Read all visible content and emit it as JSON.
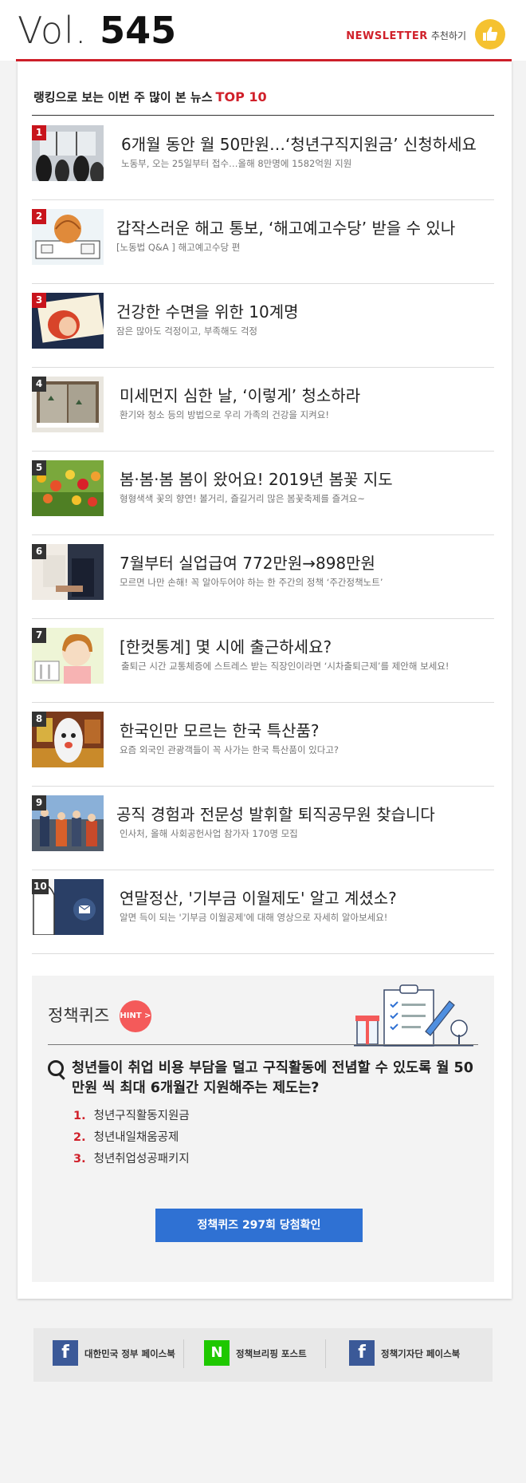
{
  "header": {
    "vol_prefix": "Vol.",
    "vol_number": "545",
    "newsletter_label": "NEWSLETTER",
    "recommend_label": "추천하기"
  },
  "ranking": {
    "title": "랭킹으로 보는 이번 주 많이 본 뉴스",
    "title_highlight": "TOP 10",
    "items": [
      {
        "rank": "1",
        "title": "6개월 동안 월 50만원…‘청년구직지원금’ 신청하세요",
        "subtitle": "노동부, 오는 25일부터 접수…올해 8만명에 1582억원 지원"
      },
      {
        "rank": "2",
        "title": "갑작스러운 해고 통보, ‘해고예고수당’ 받을 수 있나",
        "subtitle": "[노동법 Q&A ] 해고예고수당 편"
      },
      {
        "rank": "3",
        "title": "건강한 수면을 위한 10계명",
        "subtitle": "잠은 많아도 걱정이고, 부족해도 걱정"
      },
      {
        "rank": "4",
        "title": "미세먼지 심한 날, ‘이렇게’ 청소하라",
        "subtitle": "환기와 청소 등의 방법으로 우리 가족의 건강을 지켜요!"
      },
      {
        "rank": "5",
        "title": "봄·봄·봄 봄이 왔어요! 2019년 봄꽃 지도",
        "subtitle": "형형색색 꽃의 향연! 볼거리, 즐길거리 많은 봄꽃축제를 즐겨요~"
      },
      {
        "rank": "6",
        "title": "7월부터 실업급여 772만원→898만원",
        "subtitle": "모르면 나만 손해! 꼭 알아두어야 하는 한 주간의 정책 ‘주간정책노트’"
      },
      {
        "rank": "7",
        "title": "[한컷통계] 몇 시에 출근하세요?",
        "subtitle": "출퇴근 시간 교통체증에 스트레스 받는 직장인이라면 ‘시차출퇴근제’를 제안해 보세요!"
      },
      {
        "rank": "8",
        "title": "한국인만 모르는 한국 특산품?",
        "subtitle": "요즘 외국인 관광객들이 꼭 사가는 한국 특산품이 있다고?"
      },
      {
        "rank": "9",
        "title": "공직 경험과 전문성 발휘할 퇴직공무원 찾습니다",
        "subtitle": "인사처, 올해 사회공헌사업 참가자 170명 모집"
      },
      {
        "rank": "10",
        "title": "연말정산, '기부금 이월제도' 알고 계셨소?",
        "subtitle": "알면 득이 되는 '기부금 이월공제'에 대해 영상으로 자세히 알아보세요!"
      }
    ]
  },
  "quiz": {
    "title": "정책퀴즈",
    "hint_label": "HINT >",
    "question": "청년들이 취업 비용 부담을 덜고 구직활동에 전념할 수 있도록 월 50만원 씩 최대 6개월간 지원해주는 제도는?",
    "options": [
      {
        "num": "1.",
        "text": "청년구직활동지원금"
      },
      {
        "num": "2.",
        "text": "청년내일채움공제"
      },
      {
        "num": "3.",
        "text": "청년취업성공패키지"
      }
    ],
    "cta_label": "정책퀴즈 297회 당첨확인"
  },
  "footer": {
    "links": [
      {
        "icon": "f",
        "label": "대한민국 정부 페이스북"
      },
      {
        "icon": "N",
        "label": "정책브리핑 포스트"
      },
      {
        "icon": "f",
        "label": "정책기자단 페이스북"
      }
    ]
  },
  "colors": {
    "accent": "#d0202a",
    "cta": "#2f71d3",
    "facebook": "#3b5998",
    "naver": "#1ec800"
  }
}
